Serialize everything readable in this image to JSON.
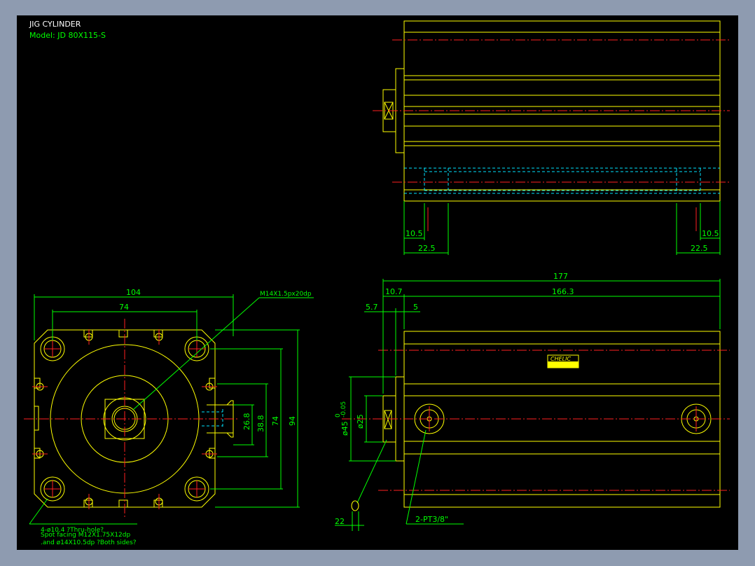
{
  "title": {
    "name": "JIG CYLINDER",
    "model": "Model:  JD  80X115-S"
  },
  "colors": {
    "background": "#000000",
    "frame": "#8e9bb0",
    "outline": "#ffff00",
    "dimension": "#00ff00",
    "centerline": "#ff2020",
    "hidden": "#00e5ff"
  },
  "front_view": {
    "dim_width": "104",
    "dim_bolt_width": "74",
    "dim_port_h1": "26.8",
    "dim_port_h2": "38.8",
    "dim_bolt_height": "74",
    "dim_height": "94",
    "note_thread": "M14X1.5px20dp",
    "note_holes_1": "4-ø10.4 ?Thru-hole?",
    "note_holes_2": "Spot facing   M12X1.75X12dp",
    "note_holes_3": ".and ø14X10.5dp ?Both sides?"
  },
  "top_view": {
    "dim_left_a": "10.5",
    "dim_left_b": "22.5",
    "dim_right_a": "10.5",
    "dim_right_b": "22.5"
  },
  "side_view": {
    "dim_total": "177",
    "dim_body": "166.3",
    "dim_rod": "10.7",
    "dim_a": "5.7",
    "dim_b": "5",
    "dim_dia_45": "ø45",
    "dim_tol_top": "0",
    "dim_tol_bot": "-0.05",
    "dim_dia_25": "ø25",
    "dim_22": "22",
    "note_ports": "2-PT3/8\"",
    "brand": "CHELIC"
  }
}
